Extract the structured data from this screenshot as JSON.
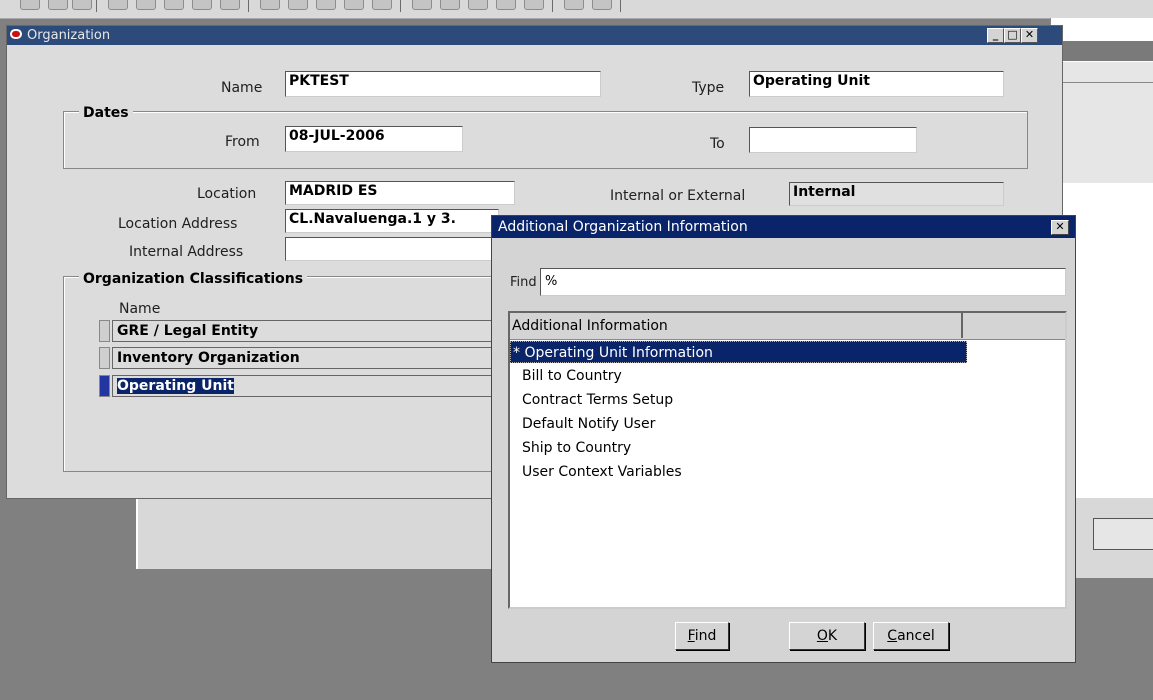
{
  "org_window": {
    "title": "Organization",
    "name_label": "Name",
    "name_value": "PKTEST",
    "type_label": "Type",
    "type_value": "Operating Unit",
    "dates_group": "Dates",
    "from_label": "From",
    "from_value": "08-JUL-2006",
    "to_label": "To",
    "to_value": "",
    "location_label": "Location",
    "location_value": "MADRID ES",
    "internal_external_label": "Internal or External",
    "internal_external_value": "Internal",
    "location_address_label": "Location Address",
    "location_address_value": "CL.Navaluenga.1 y 3.",
    "internal_address_label": "Internal Address",
    "internal_address_value": "",
    "classifications_group": "Organization Classifications",
    "classifications_name_header": "Name",
    "classifications": [
      "GRE / Legal Entity",
      "Inventory Organization",
      "Operating Unit"
    ]
  },
  "dialog": {
    "title": "Additional Organization Information",
    "find_label": "Find",
    "find_value": "%",
    "list_header": "Additional Information",
    "items": [
      "* Operating Unit Information",
      "Bill to Country",
      "Contract Terms Setup",
      "Default Notify User",
      "Ship to Country",
      "User Context Variables"
    ],
    "buttons": {
      "find_prefix": "",
      "find_mnemonic": "F",
      "find_rest": "ind",
      "ok_mnemonic": "O",
      "ok_rest": "K",
      "cancel_mnemonic": "C",
      "cancel_rest": "ancel"
    }
  },
  "window_controls": {
    "minimize": "_",
    "maximize": "□",
    "close": "✕"
  }
}
